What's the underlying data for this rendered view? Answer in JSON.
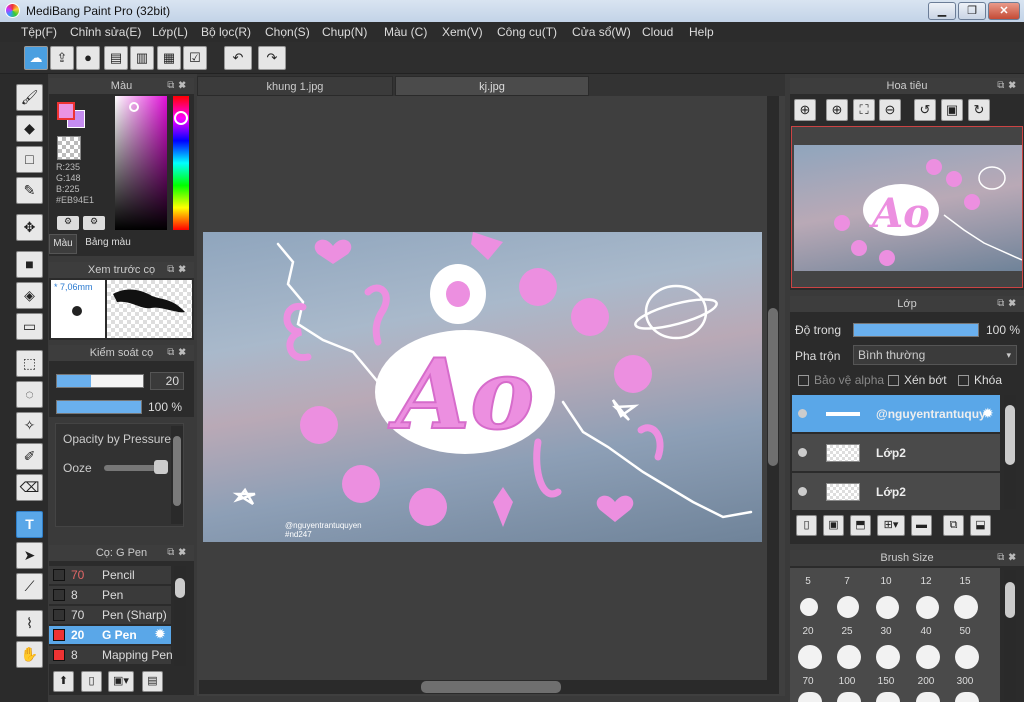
{
  "window": {
    "title": "MediBang Paint Pro (32bit)",
    "minimize": "▁",
    "maximize": "❐",
    "close": "✕"
  },
  "menu": [
    "Tệp(F)",
    "Chỉnh sửa(E)",
    "Lớp(L)",
    "Bộ lọc(R)",
    "Chọn(S)",
    "Chụp(N)",
    "Màu (C)",
    "Xem(V)",
    "Công cụ(T)",
    "Cửa sổ(W)",
    "Cloud",
    "Help"
  ],
  "toolbar_icons": [
    "cloud-icon",
    "upload-icon",
    "chat-icon",
    "comment-icon",
    "page-icon",
    "grid-page-icon",
    "checklist-icon",
    "undo-icon",
    "redo-icon"
  ],
  "color_panel": {
    "title": "Màu",
    "r": "R:235",
    "g": "G:148",
    "b": "B:225",
    "hex": "#EB94E1",
    "fg_color": "#EB94E1",
    "bg_color": "#c58cf0",
    "tabs": [
      "Màu",
      "Bảng màu"
    ]
  },
  "brush_preview": {
    "title": "Xem trước cọ",
    "size": "* 7,06mm"
  },
  "brush_control": {
    "title": "Kiểm soát cọ",
    "size_value": "20",
    "opacity_value": "100 %",
    "size_fill": 0.4,
    "opacity_fill": 1.0
  },
  "brush_settings": {
    "opacity_pressure": "Opacity by Pressure",
    "ooze": "Ooze"
  },
  "brush_list": {
    "title": "Cọ: G Pen",
    "items": [
      {
        "num": "70",
        "name": "Pencil",
        "color": "#333333",
        "numcolor": "#e06666"
      },
      {
        "num": "8",
        "name": "Pen",
        "color": "#333333",
        "numcolor": "#dddddd"
      },
      {
        "num": "70",
        "name": "Pen (Sharp)",
        "color": "#333333",
        "numcolor": "#dddddd"
      },
      {
        "num": "20",
        "name": "G Pen",
        "color": "#ee3333",
        "numcolor": "#e06666"
      },
      {
        "num": "8",
        "name": "Mapping Pen",
        "color": "#ee3333",
        "numcolor": "#dddddd"
      }
    ]
  },
  "tabs": [
    {
      "label": "khung 1.jpg"
    },
    {
      "label": "kj.jpg"
    }
  ],
  "artwork": {
    "watermark_line1": "@nguyentrantuquyen",
    "watermark_line2": "#nd247",
    "main_text": "Ao",
    "pink": "#ec8fe0"
  },
  "navigator": {
    "title": "Hoa tiêu"
  },
  "layer_panel": {
    "title": "Lớp",
    "opacity_label": "Độ trong",
    "opacity_value": "100 %",
    "blend_label": "Pha trộn",
    "blend_value": "Bình thường",
    "protect_alpha": "Bảo vệ alpha",
    "clip": "Xén bớt",
    "lock": "Khóa",
    "layers": [
      {
        "name": "@nguyentrantuquyen",
        "selected": true
      },
      {
        "name": "Lớp2",
        "selected": false
      },
      {
        "name": "Lớp2",
        "selected": false
      }
    ]
  },
  "brush_size": {
    "title": "Brush Size",
    "row1": [
      "5",
      "7",
      "10",
      "12",
      "15"
    ],
    "row2": [
      "20",
      "25",
      "30",
      "40",
      "50"
    ],
    "row3": [
      "70",
      "100",
      "150",
      "200",
      "300"
    ]
  }
}
